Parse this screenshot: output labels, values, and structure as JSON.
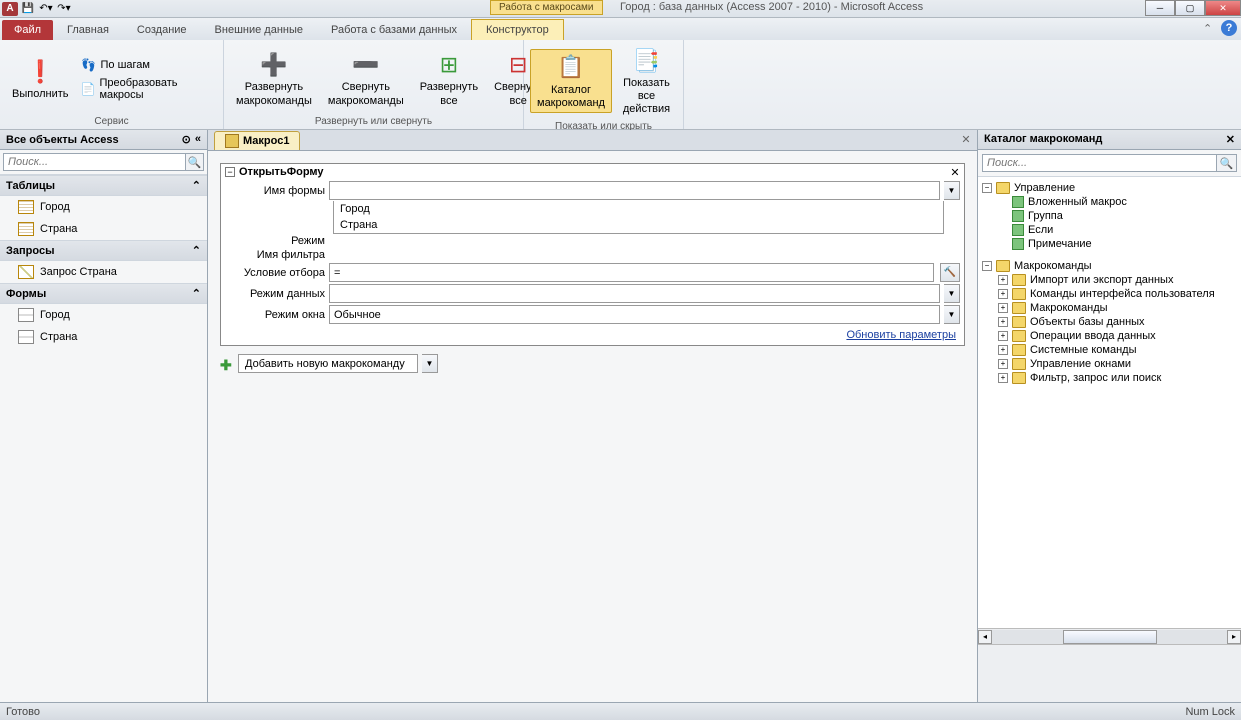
{
  "titlebar": {
    "context_label": "Работа с макросами",
    "title": "Город : база данных (Access 2007 - 2010) - Microsoft Access"
  },
  "tabs": {
    "file": "Файл",
    "home": "Главная",
    "create": "Создание",
    "external": "Внешние данные",
    "db_tools": "Работа с базами данных",
    "constructor": "Конструктор"
  },
  "ribbon": {
    "run": "Выполнить",
    "step": "По шагам",
    "convert": "Преобразовать макросы",
    "expand_actions": "Развернуть\nмакрокоманды",
    "collapse_actions": "Свернуть\nмакрокоманды",
    "expand_all": "Развернуть\nвсе",
    "collapse_all": "Свернуть\nвсе",
    "catalog": "Каталог\nмакрокоманд",
    "show_all": "Показать\nвсе действия",
    "grp_tools": "Сервис",
    "grp_expand": "Развернуть или свернуть",
    "grp_show": "Показать или скрыть"
  },
  "nav": {
    "header": "Все объекты Access",
    "search_ph": "Поиск...",
    "tables_hdr": "Таблицы",
    "tables": [
      "Город",
      "Страна"
    ],
    "queries_hdr": "Запросы",
    "queries": [
      "Запрос Страна"
    ],
    "forms_hdr": "Формы",
    "forms": [
      "Город",
      "Страна"
    ]
  },
  "doc": {
    "tab_name": "Макрос1",
    "action_name": "ОткрытьФорму",
    "labels": {
      "form_name": "Имя формы",
      "view": "Режим",
      "filter": "Имя фильтра",
      "where": "Условие отбора",
      "data_mode": "Режим данных",
      "window_mode": "Режим окна"
    },
    "values": {
      "where": "=",
      "window_mode": "Обычное"
    },
    "dropdown_opts": [
      "Город",
      "Страна"
    ],
    "update_link": "Обновить параметры",
    "add_new": "Добавить новую макрокоманду"
  },
  "catalog": {
    "title": "Каталог макрокоманд",
    "search_ph": "Поиск...",
    "flow": {
      "hdr": "Управление",
      "items": [
        "Вложенный макрос",
        "Группа",
        "Если",
        "Примечание"
      ]
    },
    "actions": {
      "hdr": "Макрокоманды",
      "items": [
        "Импорт или экспорт данных",
        "Команды интерфейса пользователя",
        "Макрокоманды",
        "Объекты базы данных",
        "Операции ввода данных",
        "Системные команды",
        "Управление окнами",
        "Фильтр, запрос или поиск"
      ]
    }
  },
  "status": {
    "ready": "Готово",
    "numlock": "Num Lock"
  }
}
